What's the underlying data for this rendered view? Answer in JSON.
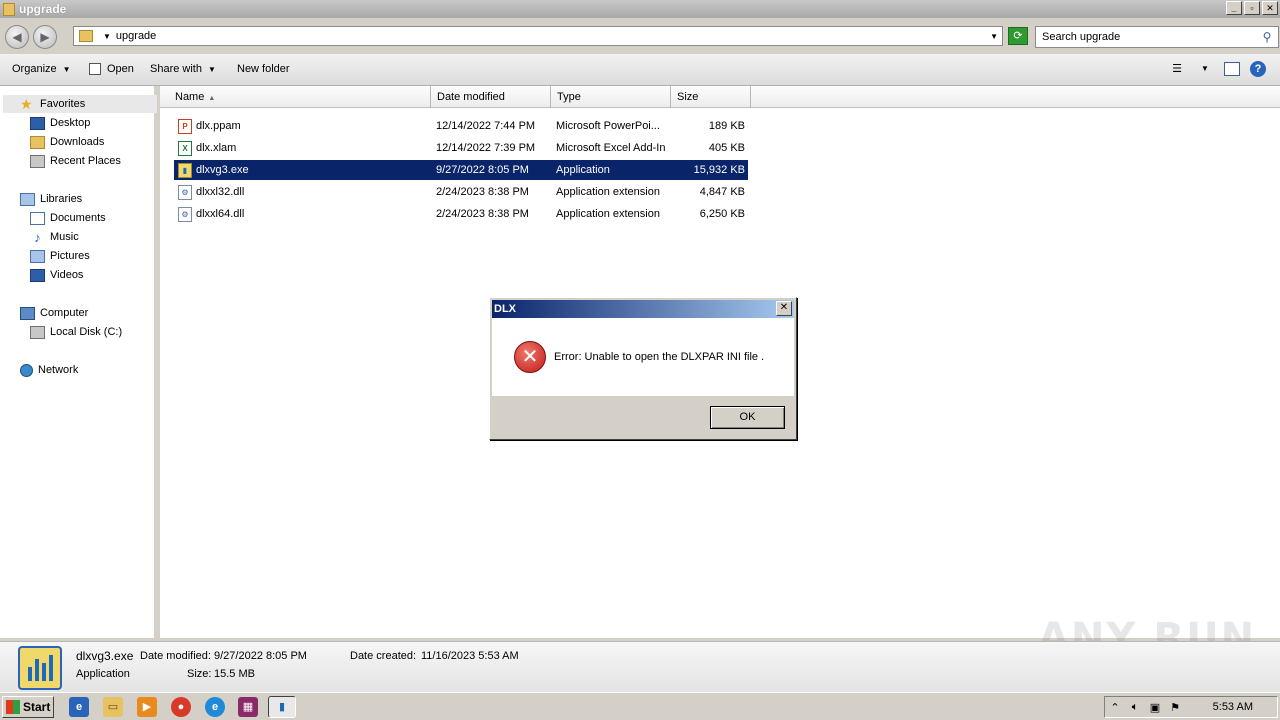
{
  "window": {
    "title": "upgrade"
  },
  "address": {
    "path": "upgrade",
    "search_placeholder": "Search upgrade"
  },
  "toolbar": {
    "organize": "Organize",
    "open": "Open",
    "share_with": "Share with",
    "new_folder": "New folder"
  },
  "nav": {
    "favorites": "Favorites",
    "fav_items": [
      "Desktop",
      "Downloads",
      "Recent Places"
    ],
    "libraries": "Libraries",
    "lib_items": [
      "Documents",
      "Music",
      "Pictures",
      "Videos"
    ],
    "computer": "Computer",
    "comp_items": [
      "Local Disk (C:)"
    ],
    "network": "Network"
  },
  "columns": {
    "name": "Name",
    "date": "Date modified",
    "type": "Type",
    "size": "Size"
  },
  "files": [
    {
      "name": "dlx.ppam",
      "date": "12/14/2022 7:44 PM",
      "type": "Microsoft PowerPoi...",
      "size": "189 KB",
      "icon": "powerpoint-addin-icon"
    },
    {
      "name": "dlx.xlam",
      "date": "12/14/2022 7:39 PM",
      "type": "Microsoft Excel Add-In",
      "size": "405 KB",
      "icon": "excel-addin-icon"
    },
    {
      "name": "dlxvg3.exe",
      "date": "9/27/2022 8:05 PM",
      "type": "Application",
      "size": "15,932 KB",
      "icon": "application-icon"
    },
    {
      "name": "dlxxl32.dll",
      "date": "2/24/2023 8:38 PM",
      "type": "Application extension",
      "size": "4,847 KB",
      "icon": "dll-icon"
    },
    {
      "name": "dlxxl64.dll",
      "date": "2/24/2023 8:38 PM",
      "type": "Application extension",
      "size": "6,250 KB",
      "icon": "dll-icon"
    }
  ],
  "details": {
    "name": "dlxvg3.exe",
    "kind": "Application",
    "date_modified_label": "Date modified:",
    "date_modified": "9/27/2022 8:05 PM",
    "date_created_label": "Date created:",
    "date_created": "11/16/2023 5:53 AM",
    "size_label": "Size:",
    "size": "15.5 MB"
  },
  "dialog": {
    "title": "DLX",
    "message": "Error:  Unable to open the DLXPAR INI file .",
    "ok": "OK"
  },
  "taskbar": {
    "start": "Start",
    "clock": "5:53 AM"
  },
  "watermark": "ANY RUN",
  "colors": {
    "selection": "#0a246a",
    "dialog_title_start": "#0a246a",
    "dialog_title_end": "#a6caf0"
  }
}
